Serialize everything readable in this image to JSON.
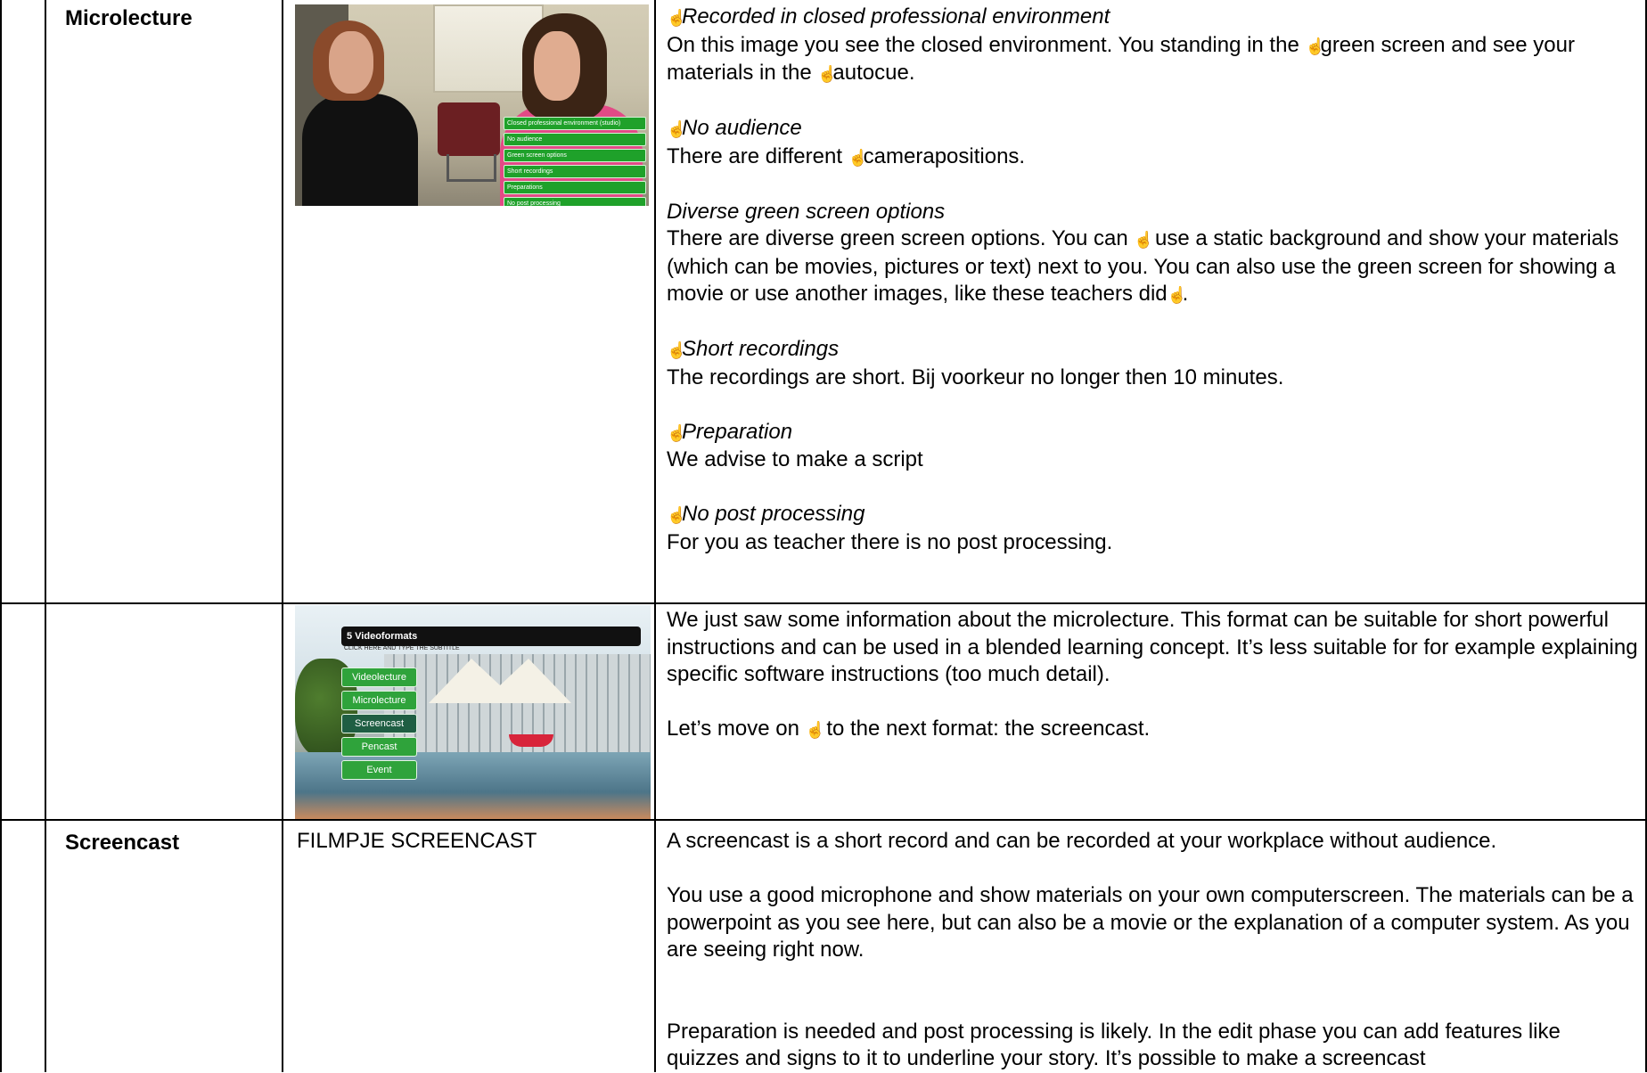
{
  "rows": [
    {
      "label": "Microlecture",
      "thumbnail": {
        "menu": [
          "Closed professional environment (studio)",
          "No audience",
          "Green screen options",
          "Short recordings",
          "Preparations",
          "No post processing"
        ]
      },
      "hand": "☝",
      "p1_title": "Recorded in closed professional environment",
      "p1_a": "On this image you see the closed environment. You standing in the ",
      "p1_b": "green screen and see your materials in the ",
      "p1_c": "autocue.",
      "p2_title": "No audience",
      "p2_a": "There are different ",
      "p2_b": "camerapositions.",
      "p3_title": "Diverse green screen options",
      "p3_a": "There are diverse green screen options. You can ",
      "p3_b": " use a static background and show your materials (which can be movies, pictures or text) next to you. You can also use the green screen for showing a movie or use another images, like these teachers did",
      "p3_c": ".",
      "p4_title": "Short recordings",
      "p4_text": "The recordings are short. Bij voorkeur no longer then 10 minutes.",
      "p5_title": "Preparation",
      "p5_text": "We advise to make a script",
      "p6_title": "No post processing",
      "p6_text": "For you as teacher there is no post processing."
    },
    {
      "thumbnail": {
        "title": "5 Videoformats",
        "subtitle": "CLICK HERE AND TYPE THE SUBTITLE",
        "menu": [
          "Videolecture",
          "Microlecture",
          "Screencast",
          "Pencast",
          "Event"
        ]
      },
      "p1": "We just saw some information about the microlecture. This format can be suitable for short powerful instructions and can be used in a blended learning concept.  It’s less suitable for for example explaining specific software instructions (too much detail).",
      "p2_a": "Let’s move on ",
      "p2_b": " to the next format: the screencast."
    },
    {
      "label": "Screencast",
      "media": "FILMPJE SCREENCAST",
      "p1": "A screencast is a short record and can be recorded at your workplace without audience.",
      "p2": "You use a good microphone and show materials on your own computerscreen. The materials can be a powerpoint as you see here, but can also be a movie or the explanation of a computer system. As you are seeing right now.",
      "p3": "Preparation is needed and post processing is likely. In the edit phase you can add features like quizzes and signs to it to underline your story.  It’s possible to make a screencast"
    }
  ]
}
